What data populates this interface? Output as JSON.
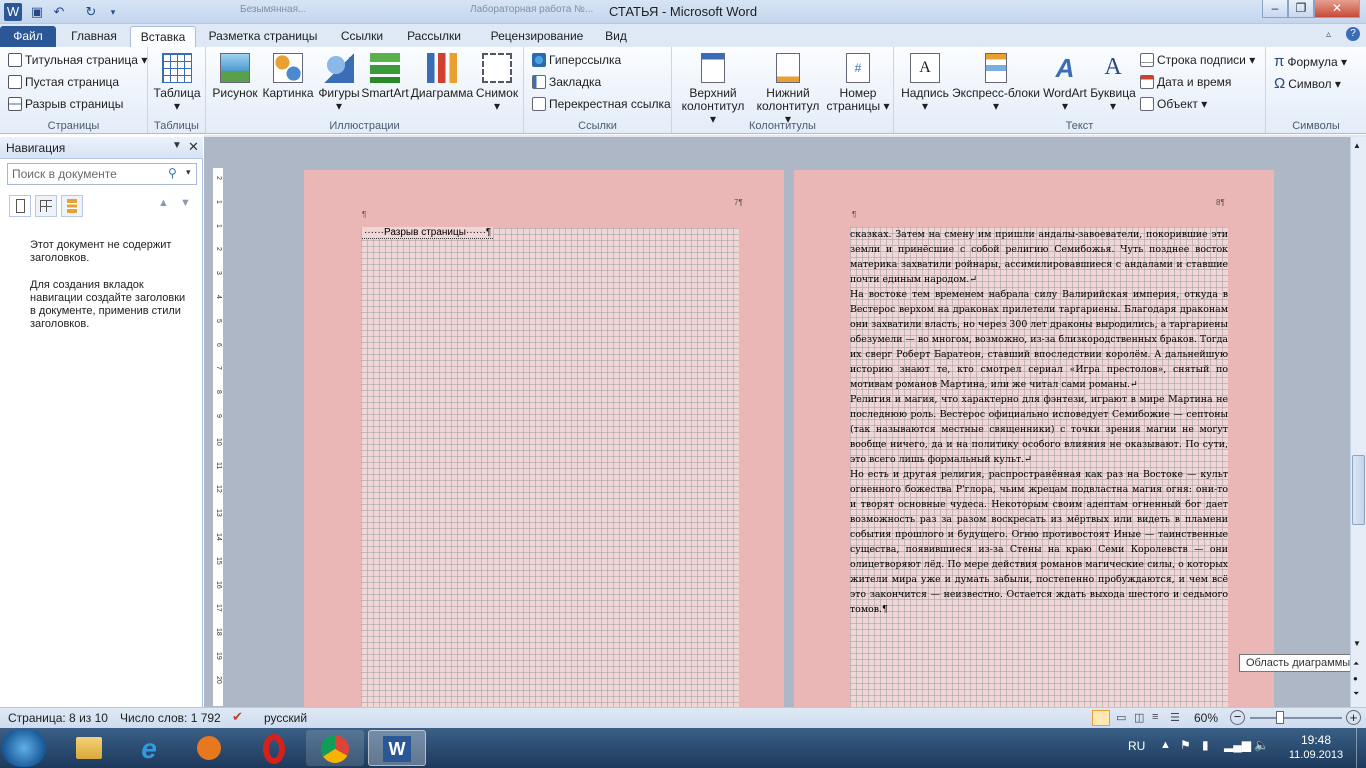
{
  "window": {
    "title": "СТАТЬЯ - Microsoft Word",
    "bg_tab1": "Безымянная...",
    "bg_tab2": "Лабораторная работа №..."
  },
  "tabs": [
    {
      "label": "Файл"
    },
    {
      "label": "Главная"
    },
    {
      "label": "Вставка"
    },
    {
      "label": "Разметка страницы"
    },
    {
      "label": "Ссылки"
    },
    {
      "label": "Рассылки"
    },
    {
      "label": "Рецензирование"
    },
    {
      "label": "Вид"
    }
  ],
  "ribbon": {
    "pages": {
      "label": "Страницы",
      "title_page": "Титульная страница",
      "blank_page": "Пустая страница",
      "page_break": "Разрыв страницы"
    },
    "tables": {
      "label": "Таблицы",
      "table": "Таблица"
    },
    "illustrations": {
      "label": "Иллюстрации",
      "picture": "Рисунок",
      "clipart": "Картинка",
      "shapes": "Фигуры",
      "smartart": "SmartArt",
      "chart": "Диаграмма",
      "screenshot": "Снимок"
    },
    "links": {
      "label": "Ссылки",
      "hyperlink": "Гиперссылка",
      "bookmark": "Закладка",
      "crossref": "Перекрестная ссылка"
    },
    "headerfooter": {
      "label": "Колонтитулы",
      "header": "Верхний колонтитул",
      "footer": "Нижний колонтитул",
      "pagenum": "Номер страницы"
    },
    "text": {
      "label": "Текст",
      "textbox": "Надпись",
      "quickparts": "Экспресс-блоки",
      "wordart": "WordArt",
      "dropcap": "Буквица",
      "sigline": "Строка подписи",
      "datetime": "Дата и время",
      "object": "Объект"
    },
    "symbols": {
      "label": "Символы",
      "equation": "Формула",
      "symbol": "Символ"
    }
  },
  "nav": {
    "title": "Навигация",
    "search_placeholder": "Поиск в документе",
    "msg1": "Этот документ не содержит заголовков.",
    "msg2": "Для создания вкладок навигации создайте заголовки в документе, применив стили заголовков."
  },
  "ruler_labels": [
    "2",
    "1",
    "1",
    "2",
    "3",
    "4",
    "5",
    "6",
    "7",
    "8",
    "9",
    "10",
    "11",
    "12",
    "13",
    "14",
    "15",
    "16",
    "17",
    "18"
  ],
  "vruler_labels": [
    "2",
    "1",
    "1",
    "2",
    "3",
    "4",
    "5",
    "6",
    "7",
    "8",
    "9",
    "10",
    "11",
    "12",
    "13",
    "14",
    "15",
    "16",
    "17",
    "18",
    "19",
    "20"
  ],
  "doc": {
    "page7_num": "7¶",
    "page8_num": "8¶",
    "pilcrow": "¶",
    "page_break_text": "Разрыв страницы",
    "paragraphs": [
      "сказках. Затем на смену им пришли андалы-завоеватели, покорившие эти земли и принёсшие с собой религию Семибожья. Чуть позднее восток материка захватили ройнары, ассимилировавшиеся с андалами и ставшие почти единым народом.↵",
      "На востоке тем временем набрала силу Валирийская империя, откуда в Вестерос верхом на драконах прилетели таргариены. Благодаря драконам они захватили власть, но через 300 лет драконы выродились, а таргариены обезумели — во многом, возможно, из-за близкородственных браков. Тогда их сверг Роберт Баратеон, ставший впоследствии королём. А дальнейшую историю знают те, кто смотрел сериал «Игра престолов», снятый по мотивам романов Мартина, или же читал сами романы.↵",
      "Религия и магия, что характерно для фэнтези, играют в мире Мартина не последнюю роль. Вестерос официально исповедует Семибожие — септоны (так называются местные священники) с точки зрения магии не могут вообще ничего, да и на политику особого влияния не оказывают. По сути, это всего лишь формальный культ.↵",
      "Но есть и другая религия, распространённая как раз на Востоке — культ огненного божества Р'глора, чьим жрецам подвластна магия огня: они-то и творят основные чудеса. Некоторым своим адептам огненный бог дает возможность раз за разом воскресать из мёртвых или видеть в пламени события прошлого и будущего. Огню противостоят Иные — таинственные существа, появившиеся из-за Стены на краю Семи Королевств — они олицетворяют лёд. По мере действия романов магические силы, о которых жители мира уже и думать забыли, постепенно пробуждаются, и чем всё это закончится — неизвестно. Остается ждать выхода шестого и седьмого томов.¶"
    ],
    "tooltip": "Область диаграммы"
  },
  "status": {
    "page": "Страница: 8 из 10",
    "words": "Число слов: 1 792",
    "lang": "русский",
    "zoom": "60%"
  },
  "taskbar": {
    "lang": "RU",
    "time": "19:48",
    "date": "11.09.2013"
  },
  "colors": {
    "accent": "#2b5797",
    "page_bg": "#ebb6b6",
    "grid_bg": "#f0d6d6"
  }
}
